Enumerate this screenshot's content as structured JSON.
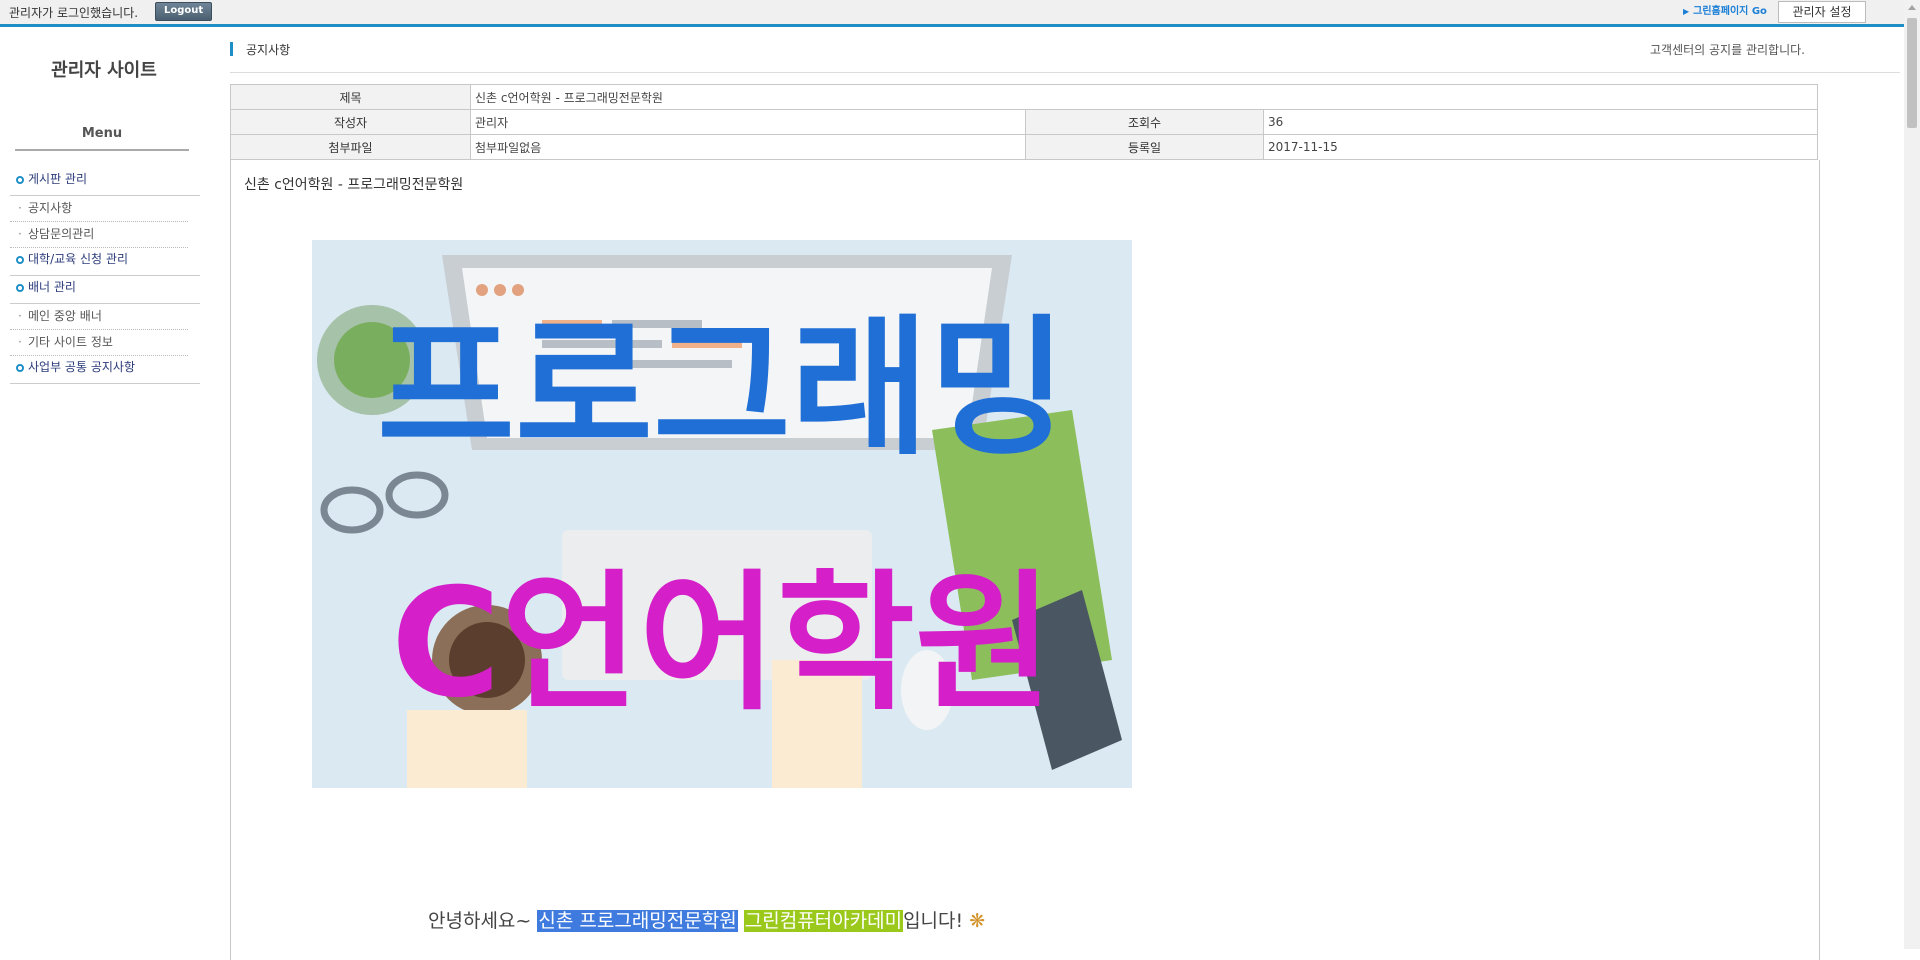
{
  "topbar": {
    "login_text": "관리자가 로그인했습니다.",
    "logout_label": "Logout",
    "homepage_link": "그린홈페이지 Go",
    "settings_label": "관리자 설정"
  },
  "sidebar": {
    "title": "관리자 사이트",
    "menu_title": "Menu",
    "groups": [
      {
        "label": "게시판 관리",
        "subs": [
          "공지사항",
          "상담문의관리"
        ]
      },
      {
        "label": "대학/교육 신청 관리",
        "subs": []
      },
      {
        "label": "배너 관리",
        "subs": [
          "메인 중앙 배너",
          "기타 사이트 정보"
        ]
      },
      {
        "label": "사업부 공통 공지사항",
        "subs": []
      }
    ]
  },
  "header": {
    "crumb": "공지사항",
    "description": "고객센터의 공지를 관리합니다."
  },
  "post": {
    "title_label": "제목",
    "title_value": "신촌 c언어학원 - 프로그래밍전문학원",
    "author_label": "작성자",
    "author_value": "관리자",
    "views_label": "조회수",
    "views_value": "36",
    "attach_label": "첨부파일",
    "attach_value": "첨부파일없음",
    "date_label": "등록일",
    "date_value": "2017-11-15",
    "body_title": "신촌 c언어학원 - 프로그래밍전문학원",
    "banner_line1": "프로그래밍",
    "banner_line2": "C언어학원",
    "greet_prefix": "안녕하세요~ ",
    "greet_hl1": "신촌 프로그래밍전문학원",
    "greet_hl2": "그린컴퓨터아카데미",
    "greet_suffix": "입니다!"
  },
  "colors": {
    "accent": "#1e8fc6",
    "banner_blue": "#1f6fd6",
    "banner_magenta": "#d51fc8"
  }
}
